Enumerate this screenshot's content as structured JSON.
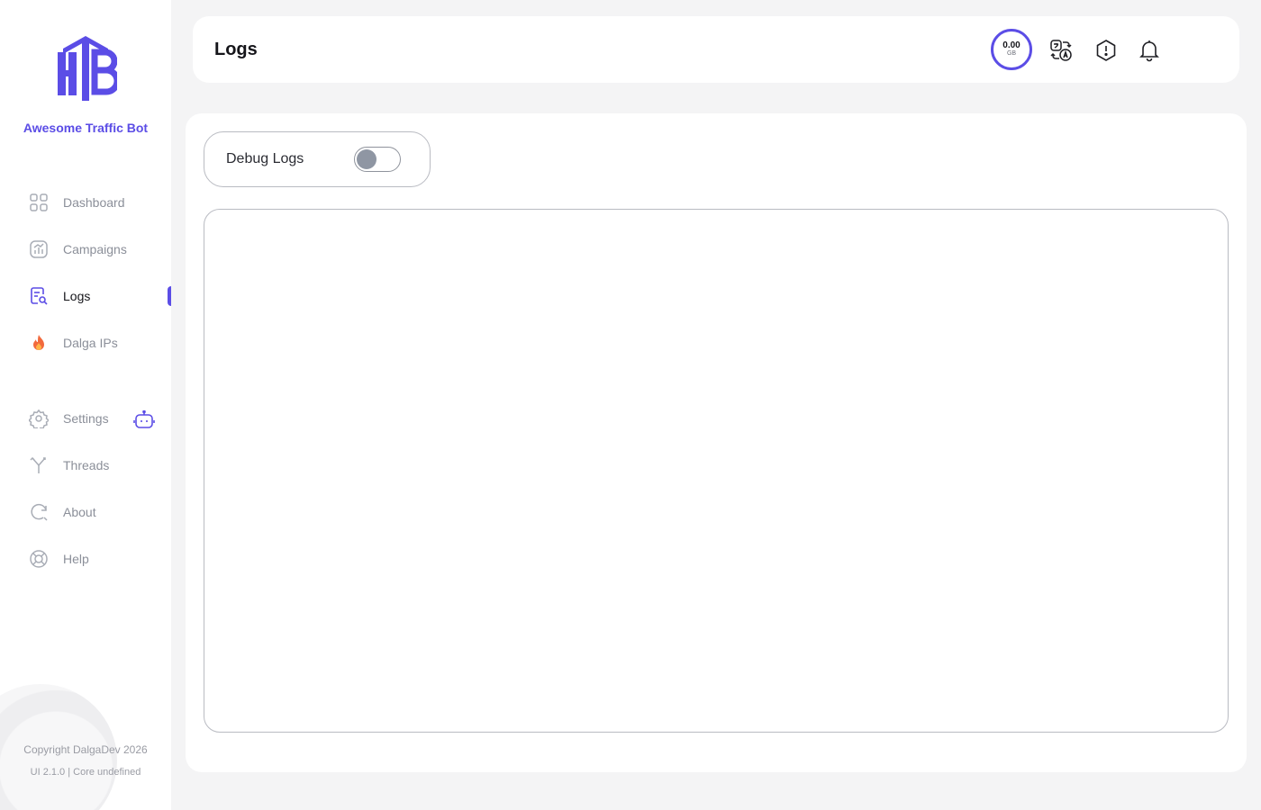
{
  "app": {
    "brand_name": "Awesome Traffic Bot",
    "accent_color": "#5b4de6"
  },
  "sidebar": {
    "items": [
      {
        "label": "Dashboard",
        "icon": "dashboard-grid-icon",
        "active": false
      },
      {
        "label": "Campaigns",
        "icon": "chart-icon",
        "active": false
      },
      {
        "label": "Logs",
        "icon": "logs-search-icon",
        "active": true
      },
      {
        "label": "Dalga IPs",
        "icon": "fire-icon",
        "active": false
      },
      {
        "label": "Settings",
        "icon": "gear-icon",
        "active": false
      },
      {
        "label": "Threads",
        "icon": "threads-fork-icon",
        "active": false
      },
      {
        "label": "About",
        "icon": "about-refresh-icon",
        "active": false
      },
      {
        "label": "Help",
        "icon": "lifebuoy-icon",
        "active": false
      }
    ],
    "extra_icon": "robot-icon",
    "footer": {
      "copyright": "Copyright DalgaDev 2026",
      "version": "UI 2.1.0 | Core undefined"
    }
  },
  "header": {
    "title": "Logs",
    "usage": {
      "value": "0.00",
      "unit": "GB"
    },
    "icons": [
      "translate-icon",
      "alert-hexagon-icon",
      "bell-icon"
    ]
  },
  "main": {
    "debug_logs": {
      "label": "Debug Logs",
      "enabled": false
    },
    "log_content": ""
  }
}
